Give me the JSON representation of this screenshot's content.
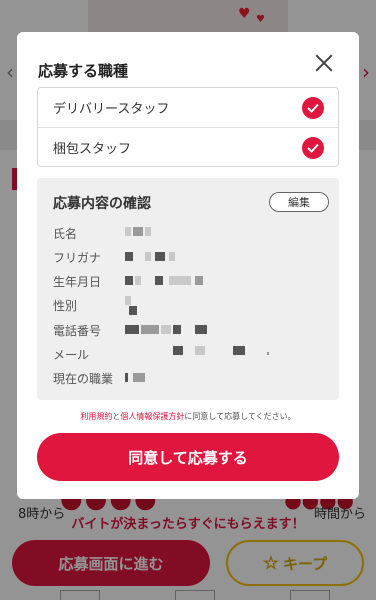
{
  "background": {
    "notice": "バイトが決まったらすぐにもらえます！",
    "partial_text": "8時から",
    "partial_text_right": "時間から",
    "apply_button": "応募画面に進む",
    "keep_button": "キープ",
    "icons": {
      "keep": "star-icon",
      "carousel_prev": "chevron-left-icon",
      "carousel_next": "chevron-right-icon"
    }
  },
  "modal": {
    "job_types_title": "応募する職種",
    "job_types": [
      {
        "label": "デリバリースタッフ",
        "checked": true
      },
      {
        "label": "梱包スタッフ",
        "checked": true
      }
    ],
    "confirm": {
      "title": "応募内容の確認",
      "edit_button": "編集",
      "fields": [
        {
          "label": "氏名"
        },
        {
          "label": "フリガナ"
        },
        {
          "label": "生年月日"
        },
        {
          "label": "性別"
        },
        {
          "label": "電話番号"
        },
        {
          "label": "メール"
        },
        {
          "label": "現在の職業"
        }
      ]
    },
    "terms": {
      "link1": "利用規約",
      "connector": "と",
      "link2": "個人情報保護方針",
      "suffix": "に同意して応募してください。"
    },
    "agree_button": "同意して応募する",
    "icons": {
      "close": "close-icon",
      "check": "checkmark-icon"
    }
  },
  "colors": {
    "accent": "#e0163f",
    "keep": "#f2c200"
  }
}
